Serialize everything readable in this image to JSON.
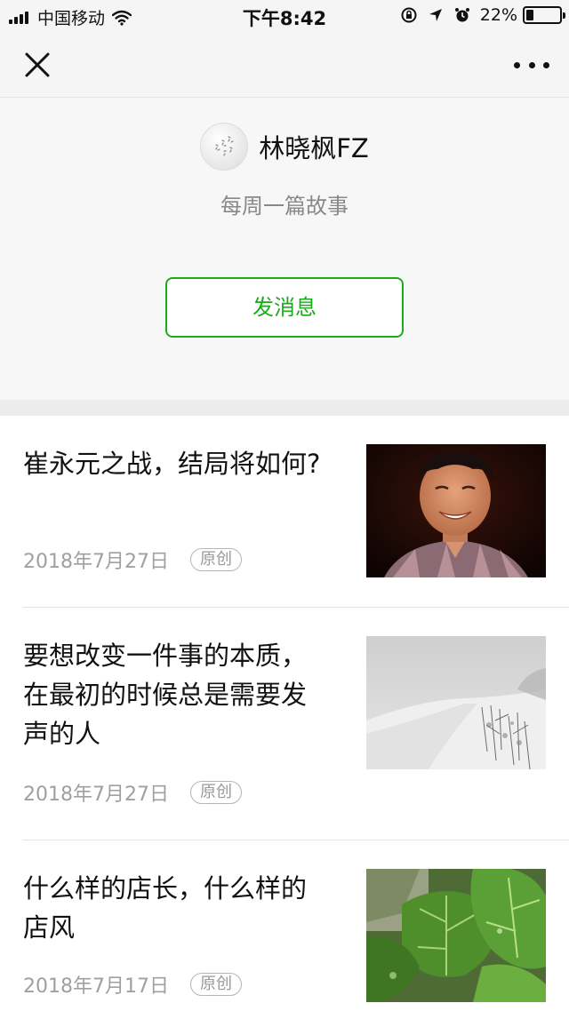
{
  "status_bar": {
    "carrier": "中国移动",
    "time": "下午8:42",
    "battery_pct": "22%",
    "battery_level": 0.22
  },
  "nav": {
    "close_icon": "close-icon",
    "more_icon": "more-icon"
  },
  "profile": {
    "name": "林晓枫FZ",
    "description": "每周一篇故事",
    "send_message_label": "发消息"
  },
  "articles": [
    {
      "title": "崔永元之战，结局将如何?",
      "date": "2018年7月27日",
      "badge": "原创",
      "thumbnail": "portrait-photo"
    },
    {
      "title": "要想改变一件事的本质，在最初的时候总是需要发声的人",
      "date": "2018年7月27日",
      "badge": "原创",
      "thumbnail": "snow-landscape-photo"
    },
    {
      "title": "什么样的店长，什么样的店风",
      "date": "2018年7月17日",
      "badge": "原创",
      "thumbnail": "green-leaves-photo"
    }
  ],
  "colors": {
    "accent": "#1aad19",
    "meta_text": "#a0a0a0"
  }
}
